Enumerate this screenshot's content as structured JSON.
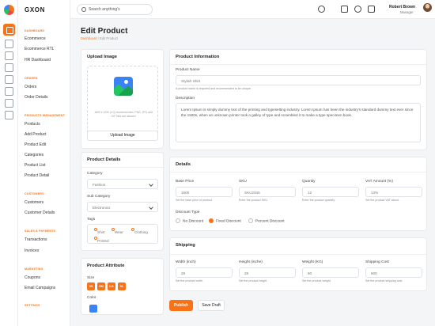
{
  "brand": {
    "name": "GXON"
  },
  "sidebar": {
    "sections": [
      {
        "title": "DASHBOARD",
        "items": [
          "Ecommerce",
          "Ecommerce RTL",
          "HR Dashboard"
        ]
      },
      {
        "title": "ORDERS",
        "items": [
          "Orders",
          "Order Details"
        ]
      },
      {
        "title": "PRODUCTS MANAGEMENT",
        "items": [
          "Products",
          "Add Product",
          "Product Edit",
          "Categories",
          "Product List",
          "Product Detail"
        ]
      },
      {
        "title": "CUSTOMERS",
        "items": [
          "Customers",
          "Customer Details"
        ]
      },
      {
        "title": "SALES & PAYMENTS",
        "items": [
          "Transactions",
          "Invoices"
        ]
      },
      {
        "title": "MARKETING",
        "items": [
          "Coupons",
          "Email Campaigns"
        ]
      },
      {
        "title": "SETTINGS",
        "items": []
      }
    ]
  },
  "topbar": {
    "search_placeholder": "Search anything's",
    "user_name": "Robert Brown",
    "user_role": "Manager"
  },
  "page": {
    "title": "Edit Product",
    "breadcrumb": [
      "Dashboard",
      "Edit Product"
    ],
    "breadcrumb_sep": "/"
  },
  "upload": {
    "title": "Upload Image",
    "hint": "1600 x 1200 (4:3) recommended. PNG, JPG and GIF files are allowed",
    "button": "Upload Image"
  },
  "details": {
    "title": "Product Details",
    "category_label": "Category",
    "category_value": "Fashion",
    "subcategory_label": "Sub Category",
    "subcategory_value": "Electronics",
    "tags_label": "Tags",
    "tags": [
      "Shirt",
      "Wear",
      "Clothing",
      "Printed"
    ]
  },
  "attribute": {
    "title": "Product Attribute",
    "size_label": "Size",
    "sizes": [
      "XS",
      "SM",
      "LG",
      "XL"
    ],
    "color_label": "Color",
    "color": "#3b82f6"
  },
  "info": {
    "title": "Product Information",
    "name_label": "Product Name",
    "name_value": "Stylish Shirt",
    "name_hint": "A product name is required and recommended to be unique.",
    "desc_label": "Description",
    "desc_value": "Lorem Ipsum is simply dummy text of the printing and typesetting industry. Lorem Ipsum has been the industry's standard dummy text ever since the 1500s, when an unknown printer took a galley of type and scrambled it to make a type specimen book."
  },
  "pricing": {
    "title": "Details",
    "fields": [
      {
        "label": "Base Price",
        "value": "1500",
        "hint": "Set the base price of product."
      },
      {
        "label": "SKU",
        "value": "SKU2345",
        "hint": "Enter the product SKU."
      },
      {
        "label": "Quantiy",
        "value": "12",
        "hint": "Enter the product quantity."
      },
      {
        "label": "VAT Amount (%)",
        "value": "13%",
        "hint": "Set the product VAT about."
      }
    ],
    "discount_label": "Discount Type",
    "discount_options": [
      "No Discount",
      "Fixed Discount",
      "Percent Discount"
    ],
    "discount_selected": "Fixed Discount"
  },
  "shipping": {
    "title": "Shipping",
    "fields": [
      {
        "label": "Width (inch)",
        "value": "28",
        "hint": "Set the product width."
      },
      {
        "label": "Height (inche)",
        "value": "28",
        "hint": "Set the product height."
      },
      {
        "label": "Weight (KG)",
        "value": "50",
        "hint": "Set the product weight."
      },
      {
        "label": "Shipping Cost",
        "value": "500",
        "hint": "Set the product shipping cost."
      }
    ]
  },
  "actions": {
    "publish": "Publish",
    "save_draft": "Save Draft"
  },
  "colors": {
    "accent": "#f97316",
    "background": "#f4f5f7"
  }
}
